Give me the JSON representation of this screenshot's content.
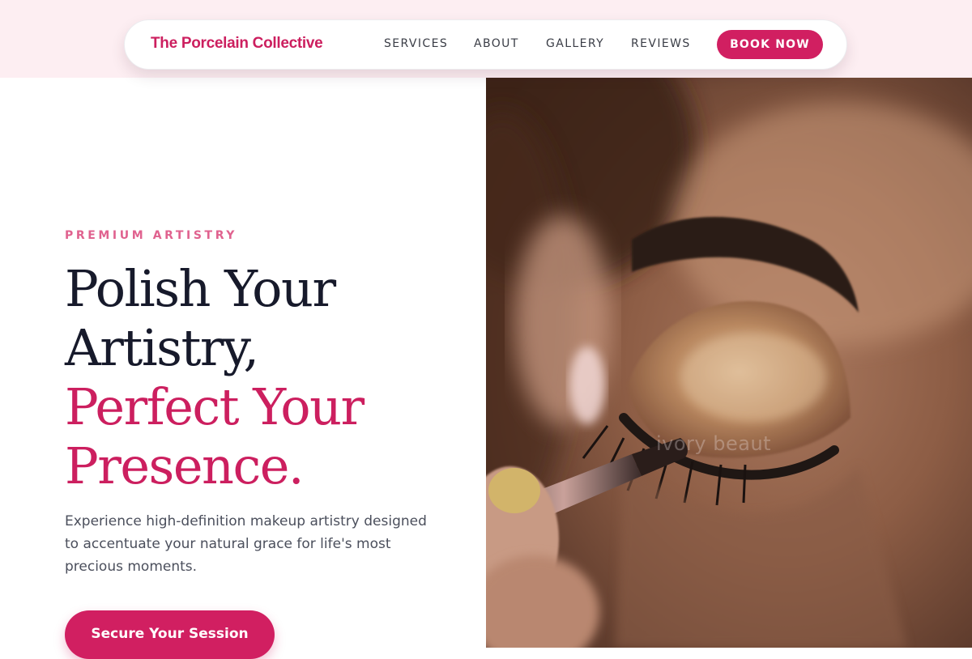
{
  "brand": {
    "name": "The Porcelain Collective",
    "color": "#cc1f5f"
  },
  "nav": {
    "items": [
      {
        "label": "SERVICES"
      },
      {
        "label": "ABOUT"
      },
      {
        "label": "GALLERY"
      },
      {
        "label": "REVIEWS"
      }
    ],
    "cta_label": "BOOK NOW"
  },
  "hero": {
    "eyebrow": "PREMIUM ARTISTRY",
    "headline": {
      "line1": "Polish Your",
      "line2": "Artistry,",
      "line3": "Perfect Your",
      "line4": "Presence."
    },
    "description": "Experience high-definition makeup artistry designed to accentuate your natural grace for life's most precious moments.",
    "cta_label": "Secure Your Session",
    "image": {
      "subject": "close-up of makeup brush applying eyeshadow to a closed eye",
      "watermark": "ivory beaut"
    }
  },
  "colors": {
    "accent": "#d11f61",
    "heading": "#171a2b",
    "eyebrow": "#e0628f",
    "band": "#fdeef2"
  }
}
